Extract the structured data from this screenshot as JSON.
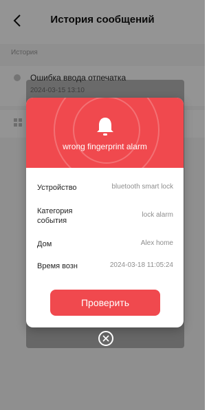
{
  "header": {
    "title": "История сообщений"
  },
  "section_label": "История",
  "list": [
    {
      "title": "Ошибка ввода отпечатка",
      "time": "2024-03-15 13:10"
    }
  ],
  "modal": {
    "alarm_text": "wrong fingerprint alarm",
    "rows": [
      {
        "label": "Устройство",
        "value": "bluetooth smart lock"
      },
      {
        "label": "Категория события",
        "value": "lock alarm"
      },
      {
        "label": "Дом",
        "value": "Alex home"
      },
      {
        "label": "Время возн",
        "value": "2024-03-18 11:05:24"
      }
    ],
    "check_button": "Проверить"
  },
  "colors": {
    "accent": "#f0494e"
  },
  "icons": {
    "back": "chevron-left-icon",
    "alarm": "bell-icon",
    "close": "close-icon"
  }
}
